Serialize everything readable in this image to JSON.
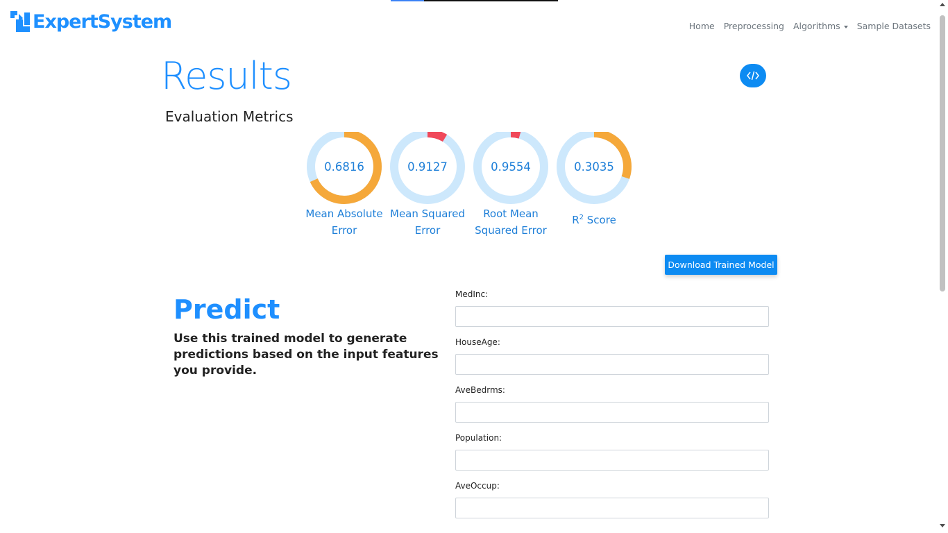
{
  "brand": {
    "name": "ExpertSystem"
  },
  "nav": {
    "home": "Home",
    "preprocessing": "Preprocessing",
    "algorithms": "Algorithms",
    "sample_datasets": "Sample Datasets"
  },
  "page": {
    "title": "Results",
    "section_heading": "Evaluation Metrics",
    "download_label": "Download Trained Model"
  },
  "metrics": [
    {
      "value": "0.6816",
      "fraction": 0.6816,
      "label": "Mean Absolute Error",
      "color": "#f5a83a"
    },
    {
      "value": "0.9127",
      "fraction": 0.9127,
      "label": "Mean Squared Error",
      "color": "#f0485a"
    },
    {
      "value": "0.9554",
      "fraction": 0.9554,
      "label": "Root Mean Squared Error",
      "color": "#f0485a"
    },
    {
      "value": "0.3035",
      "fraction": 0.3035,
      "label": "R2 Score",
      "color": "#f5a83a"
    }
  ],
  "predict": {
    "title": "Predict",
    "description": "Use this trained model to generate predictions based on the input features you provide.",
    "fields": [
      {
        "label": "MedInc:",
        "value": ""
      },
      {
        "label": "HouseAge:",
        "value": ""
      },
      {
        "label": "AveBedrms:",
        "value": ""
      },
      {
        "label": "Population:",
        "value": ""
      },
      {
        "label": "AveOccup:",
        "value": ""
      }
    ]
  },
  "colors": {
    "accent": "#1e8fff",
    "button": "#0d8bf2",
    "ring_track": "#cde8fc",
    "ring_orange": "#f5a83a",
    "ring_red": "#f0485a"
  }
}
